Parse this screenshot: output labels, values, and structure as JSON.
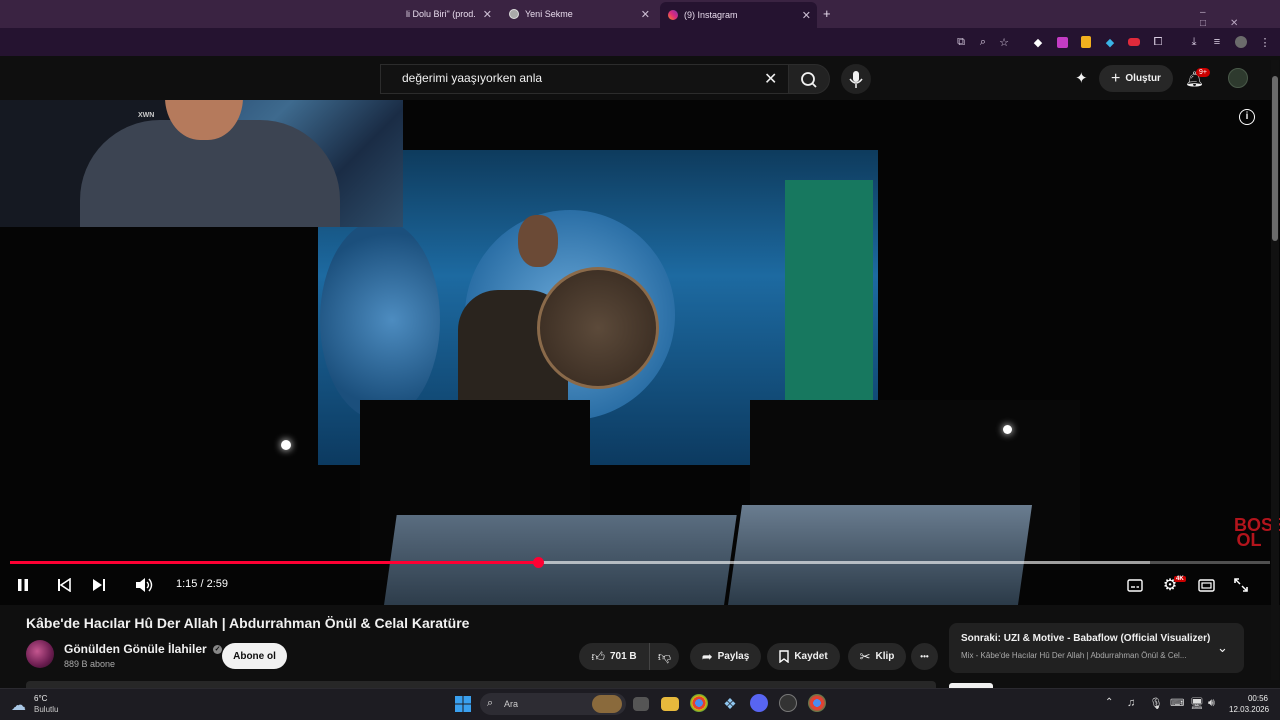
{
  "browser": {
    "tabs": [
      {
        "label": "li Dolu Biri\" (prod. S",
        "color": "#e03b3b"
      },
      {
        "label": "Yeni Sekme",
        "color": "#cccccc"
      },
      {
        "label": "(9) Instagram",
        "color": "#e1306c"
      }
    ],
    "new_tab": "+"
  },
  "header": {
    "search_value": "değerimi yaaşıyorken anla",
    "create_label": "Oluştur",
    "notification_badge": "9+"
  },
  "video": {
    "current_time": "1:15",
    "duration": "2:59",
    "time_display": "1:15 / 2:59",
    "progress_fraction": 0.419,
    "buffered_fraction": 0.905,
    "watermark": "BOSS OL",
    "quality_badge": "4K"
  },
  "meta": {
    "title": "Kâbe'de Hacılar Hû Der Allah | Abdurrahman Önül & Celal Karatüre",
    "channel": "Gönülden Gönüle İlahiler",
    "subscribers": "889 B abone",
    "subscribe_label": "Abone ol",
    "likes": "701 B",
    "share_label": "Paylaş",
    "save_label": "Kaydet",
    "clip_label": "Klip",
    "more_label": "•••"
  },
  "up_next": {
    "title": "Sonraki: UZI & Motive - Babaflow (Official Visualizer)",
    "subtitle": "Mix - Kâbe'de Hacılar Hû Der Allah | Abdurrahman Önül & Cel..."
  },
  "taskbar": {
    "weather_temp": "6°C",
    "weather_desc": "Bulutlu",
    "search_label": "Ara",
    "time": "00:56",
    "date": "12.03.2026"
  },
  "colors": {
    "accent": "#ff0033",
    "chrome": "#3a2342"
  }
}
